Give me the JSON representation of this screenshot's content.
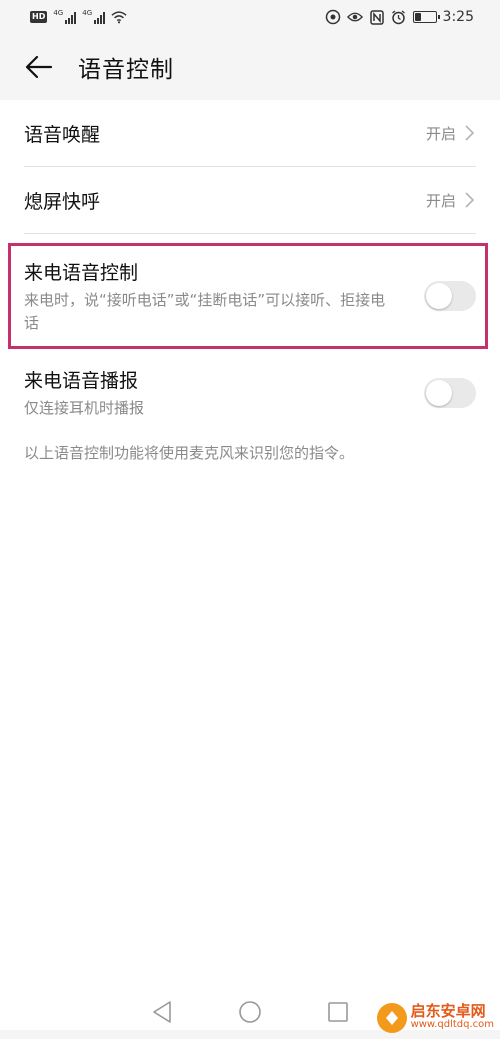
{
  "status_bar": {
    "badge": "HD",
    "network_1": "4G",
    "network_2": "4G",
    "time": "3:25",
    "battery_level": 0.3,
    "icons": [
      "hd-icon",
      "signal-icon",
      "wifi-icon",
      "eye-comfort-icon",
      "eye-icon",
      "nfc-icon",
      "alarm-icon",
      "battery-icon"
    ]
  },
  "header": {
    "back_icon": "arrow-left-icon",
    "title": "语音控制"
  },
  "settings": {
    "voice_wakeup": {
      "label": "语音唤醒",
      "value": "开启"
    },
    "screen_off_call": {
      "label": "熄屏快呼",
      "value": "开启"
    },
    "incoming_call_control": {
      "label": "来电语音控制",
      "description": "来电时，说“接听电话”或“挂断电话”可以接听、拒接电话",
      "enabled": false
    },
    "incoming_call_announce": {
      "label": "来电语音播报",
      "description": "仅连接耳机时播报",
      "enabled": false
    }
  },
  "footnote": "以上语音控制功能将使用麦克风来识别您的指令。",
  "colors": {
    "highlight": "#c5316e",
    "background": "#f5f5f5",
    "secondary_text": "#8a8a8a",
    "toggle_off": "#e9e9e9"
  },
  "nav_bar": {
    "icons": [
      "back-triangle-icon",
      "home-circle-icon",
      "recents-square-icon"
    ]
  },
  "watermark": {
    "title": "启东安卓网",
    "url": "www.qdltdq.com"
  }
}
